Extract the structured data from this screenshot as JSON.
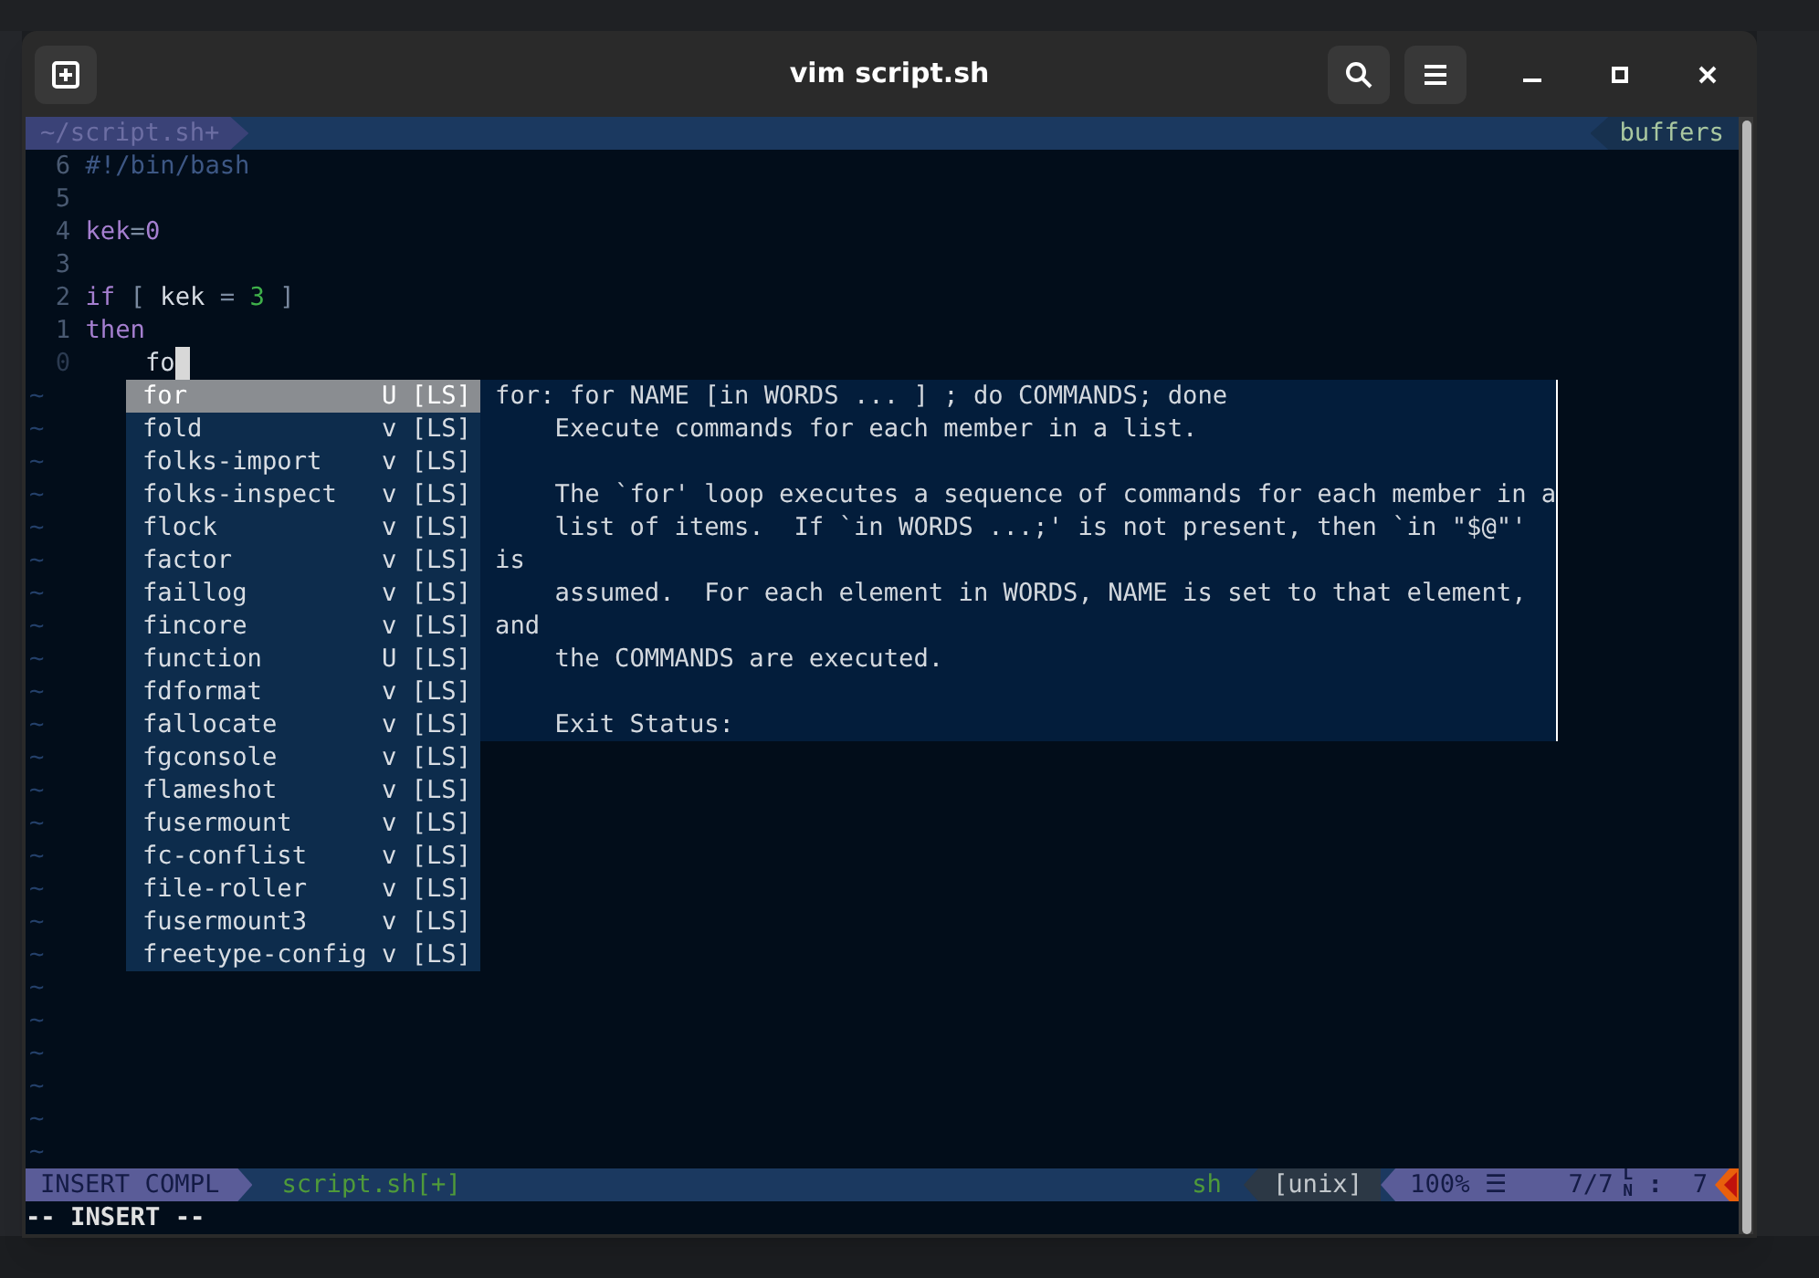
{
  "window": {
    "title": "vim script.sh"
  },
  "tabline": {
    "tab": "~/script.sh+",
    "right": "buffers"
  },
  "lines": [
    {
      "number": "6",
      "current": false,
      "cursor": false,
      "tokens": [
        {
          "kind": "comment",
          "text": "#!/bin/bash"
        }
      ]
    },
    {
      "number": "5",
      "current": false,
      "cursor": false
    },
    {
      "number": "4",
      "current": false,
      "cursor": false,
      "tokens": [
        {
          "kind": "keyword",
          "text": "kek"
        },
        {
          "kind": "operator",
          "text": "="
        },
        {
          "kind": "keyword",
          "text": "0"
        }
      ]
    },
    {
      "number": "3",
      "current": false,
      "cursor": false
    },
    {
      "number": "2",
      "current": false,
      "cursor": false,
      "tokens": [
        {
          "kind": "keyword",
          "text": "if"
        },
        {
          "kind": "operator",
          "text": " [ "
        },
        {
          "kind": "plain",
          "text": "kek"
        },
        {
          "kind": "operator",
          "text": " = "
        },
        {
          "kind": "number",
          "text": "3"
        },
        {
          "kind": "operator",
          "text": " ]"
        }
      ]
    },
    {
      "number": "1",
      "current": false,
      "cursor": false,
      "tokens": [
        {
          "kind": "keyword",
          "text": "then"
        }
      ]
    },
    {
      "number": "0",
      "current": true,
      "cursor": true,
      "tokens": [
        {
          "kind": "plain",
          "text": "    fo"
        }
      ]
    }
  ],
  "filler": [
    "~",
    "~",
    "~",
    "~",
    "~",
    "~",
    "~",
    "~",
    "~",
    "~",
    "~",
    "~",
    "~",
    "~",
    "~",
    "~",
    "~",
    "~",
    "~",
    "~",
    "~",
    "~",
    "~",
    "~"
  ],
  "completion": {
    "items": [
      {
        "word": "for",
        "kind": "U",
        "source": "[LS]",
        "selected": true
      },
      {
        "word": "fold",
        "kind": "v",
        "source": "[LS]",
        "selected": false
      },
      {
        "word": "folks-import",
        "kind": "v",
        "source": "[LS]",
        "selected": false
      },
      {
        "word": "folks-inspect",
        "kind": "v",
        "source": "[LS]",
        "selected": false
      },
      {
        "word": "flock",
        "kind": "v",
        "source": "[LS]",
        "selected": false
      },
      {
        "word": "factor",
        "kind": "v",
        "source": "[LS]",
        "selected": false
      },
      {
        "word": "faillog",
        "kind": "v",
        "source": "[LS]",
        "selected": false
      },
      {
        "word": "fincore",
        "kind": "v",
        "source": "[LS]",
        "selected": false
      },
      {
        "word": "function",
        "kind": "U",
        "source": "[LS]",
        "selected": false
      },
      {
        "word": "fdformat",
        "kind": "v",
        "source": "[LS]",
        "selected": false
      },
      {
        "word": "fallocate",
        "kind": "v",
        "source": "[LS]",
        "selected": false
      },
      {
        "word": "fgconsole",
        "kind": "v",
        "source": "[LS]",
        "selected": false
      },
      {
        "word": "flameshot",
        "kind": "v",
        "source": "[LS]",
        "selected": false
      },
      {
        "word": "fusermount",
        "kind": "v",
        "source": "[LS]",
        "selected": false
      },
      {
        "word": "fc-conflist",
        "kind": "v",
        "source": "[LS]",
        "selected": false
      },
      {
        "word": "file-roller",
        "kind": "v",
        "source": "[LS]",
        "selected": false
      },
      {
        "word": "fusermount3",
        "kind": "v",
        "source": "[LS]",
        "selected": false
      },
      {
        "word": "freetype-config",
        "kind": "v",
        "source": "[LS]",
        "selected": false
      }
    ],
    "info_paragraphs": [
      [
        "for: for NAME [in WORDS ... ] ; do COMMANDS; done",
        "    Execute commands for each member in a list."
      ],
      [
        "    The `for' loop executes a sequence of commands for each member in a",
        "    list of items.  If `in WORDS ...;' is not present, then `in \"$@\"'",
        "is",
        "    assumed.  For each element in WORDS, NAME is set to that element,",
        "and",
        "    the COMMANDS are executed."
      ],
      [
        "    Exit Status:"
      ]
    ]
  },
  "statusline": {
    "mode": "INSERT COMPL",
    "file": "script.sh[+]",
    "filetype": "sh",
    "format": "[unix]",
    "percent": "100%",
    "percent_icon": "☰",
    "position": "7/7",
    "line_glyph": [
      "L",
      "N"
    ],
    "separator": ":",
    "column": "7"
  },
  "command_line": "-- INSERT --"
}
